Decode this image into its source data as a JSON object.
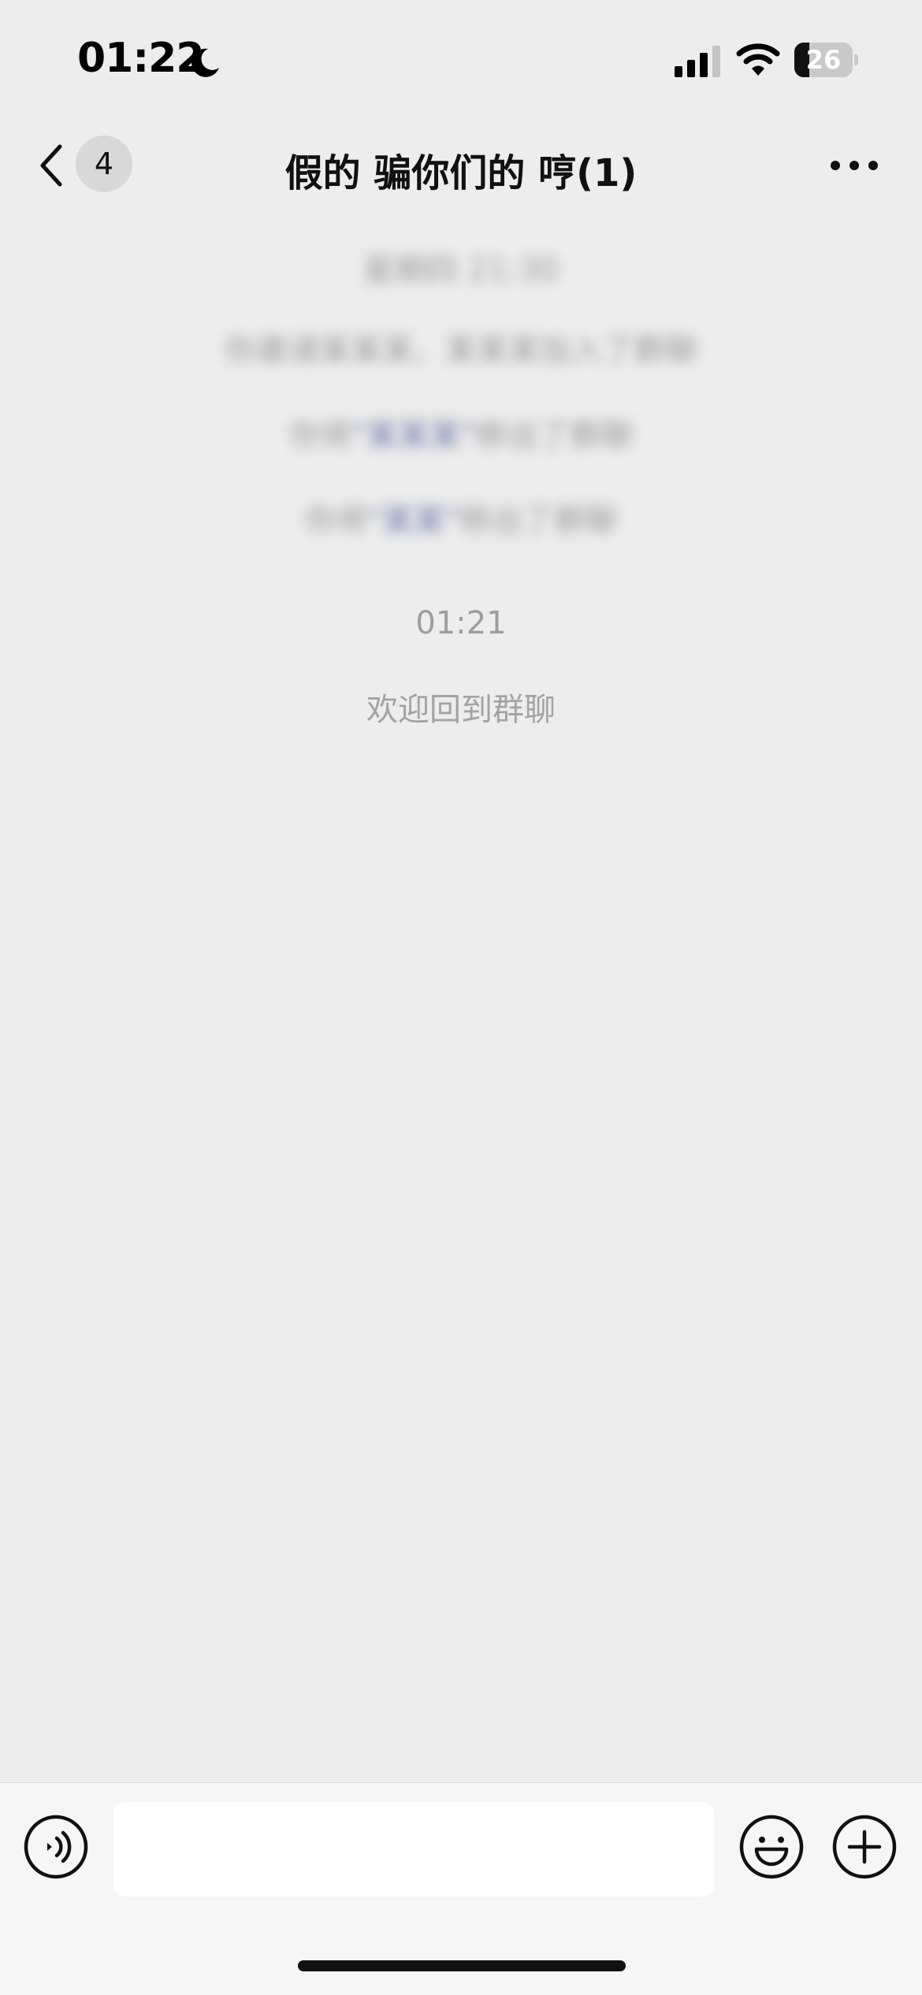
{
  "status_bar": {
    "time": "01:22",
    "battery": "26",
    "battery_level_percent": 26,
    "moon_icon": "moon-icon",
    "signal_icon": "cellular-signal-icon",
    "wifi_icon": "wifi-icon"
  },
  "nav": {
    "unread_count": "4",
    "title": "假的 骗你们的 哼(1)",
    "back_icon": "chevron-left-icon",
    "more_icon": "more-dots-icon"
  },
  "messages": {
    "blurred_lines": [
      {
        "text": "星期四 21:30"
      },
      {
        "pre": "你邀请",
        "link": "",
        "post": "某某某、某某某加入了群聊"
      },
      {
        "pre": "你将",
        "link": "\"某某某\"",
        "post": "移出了群聊"
      },
      {
        "pre": "你将",
        "link": "\"某某\"",
        "post": "移出了群聊"
      }
    ],
    "timestamp": "01:21",
    "welcome": "欢迎回到群聊"
  },
  "input_bar": {
    "placeholder": "",
    "voice_icon": "voice-icon",
    "emoji_icon": "emoji-icon",
    "plus_icon": "plus-icon"
  },
  "colors": {
    "background": "#ededed",
    "input_bar": "#f6f6f6",
    "system_text": "#a3a3a3",
    "badge": "#d8d8d8"
  }
}
